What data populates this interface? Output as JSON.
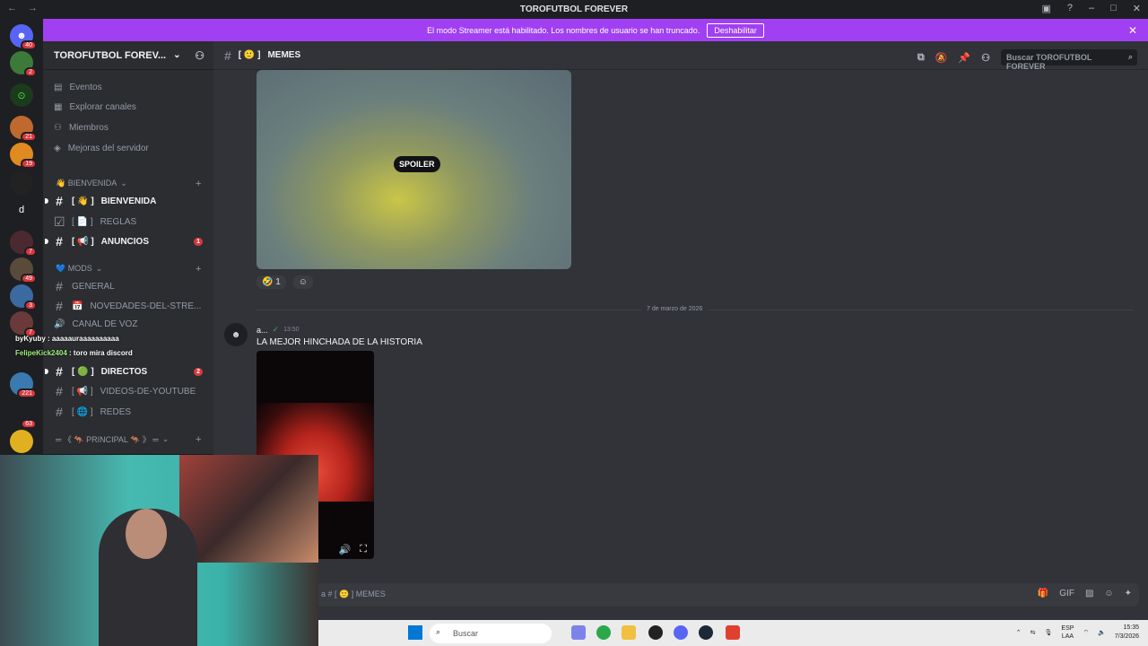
{
  "window": {
    "title": "TOROFUTBOL FOREVER"
  },
  "banner": {
    "text": "El modo Streamer está habilitado. Los nombres de usuario se han truncado.",
    "button": "Deshabilitar"
  },
  "servers": [
    {
      "label": "",
      "badge": "40"
    },
    {
      "label": "",
      "badge": "2"
    },
    {
      "label": "",
      "badge": ""
    },
    {
      "label": "",
      "badge": "21"
    },
    {
      "label": "",
      "badge": "19"
    },
    {
      "label": "",
      "badge": ""
    },
    {
      "label": "d",
      "badge": ""
    },
    {
      "label": "",
      "badge": "7"
    },
    {
      "label": "",
      "badge": "49"
    },
    {
      "label": "",
      "badge": "3"
    },
    {
      "label": "",
      "badge": "7"
    },
    {
      "label": "",
      "badge": "221"
    },
    {
      "label": "",
      "badge": "63"
    },
    {
      "label": "",
      "badge": ""
    }
  ],
  "sidebar": {
    "server_name": "TOROFUTBOL FOREV...",
    "nav": [
      "Eventos",
      "Explorar canales",
      "Miembros",
      "Mejoras del servidor"
    ],
    "categories": [
      "👋 BIENVENIDA",
      "💙 MODS",
      "═ 《 🦘 PRINCIPAL 🦘 》 ═"
    ],
    "channels": [
      {
        "name": "BIENVENIDA",
        "prefix": "[ 👋 ]",
        "unread": ""
      },
      {
        "name": "REGLAS",
        "prefix": "[ 📄 ]",
        "unread": ""
      },
      {
        "name": "ANUNCIOS",
        "prefix": "[ 📢 ]",
        "unread": "1"
      },
      {
        "name": "GENERAL",
        "prefix": "",
        "unread": ""
      },
      {
        "name": "NOVEDADES-DEL-STRE...",
        "prefix": "📅",
        "unread": ""
      },
      {
        "name": "CANAL DE VOZ",
        "prefix": "🔊",
        "unread": ""
      },
      {
        "name": "DIRECTOS",
        "prefix": "[ 🟢 ]",
        "unread": "2"
      },
      {
        "name": "VIDEOS-DE-YOUTUBE",
        "prefix": "[ 📢 ]",
        "unread": ""
      },
      {
        "name": "REDES",
        "prefix": "[ 🌐 ]",
        "unread": ""
      }
    ]
  },
  "header": {
    "channel": "MEMES",
    "prefix": "[ 🙂 ]",
    "search_placeholder": "Buscar TOROFUTBOL FOREVER"
  },
  "messages": {
    "spoiler_label": "SPOILER",
    "reaction_count": "1",
    "date_divider": "7 de marzo de 2026",
    "author": "a...",
    "time": "13:50",
    "text": "LA MEJOR HINCHADA DE LA HISTORIA"
  },
  "composer": {
    "placeholder": "a # [ 🙂 ] MEMES"
  },
  "stream_chat": [
    {
      "user": "byKyuby",
      "text": ": aaaaauraaaaaaaaaa"
    },
    {
      "user": "FelipeKick2404",
      "text": ": toro mira discord"
    }
  ],
  "taskbar": {
    "search": "Buscar",
    "lang": "ESP",
    "layout": "LAA",
    "time": "15:35",
    "date": "7/3/2026"
  },
  "colors": {
    "banner": "#a040f2",
    "unread": "#da373c",
    "accent": "#5865f2"
  }
}
